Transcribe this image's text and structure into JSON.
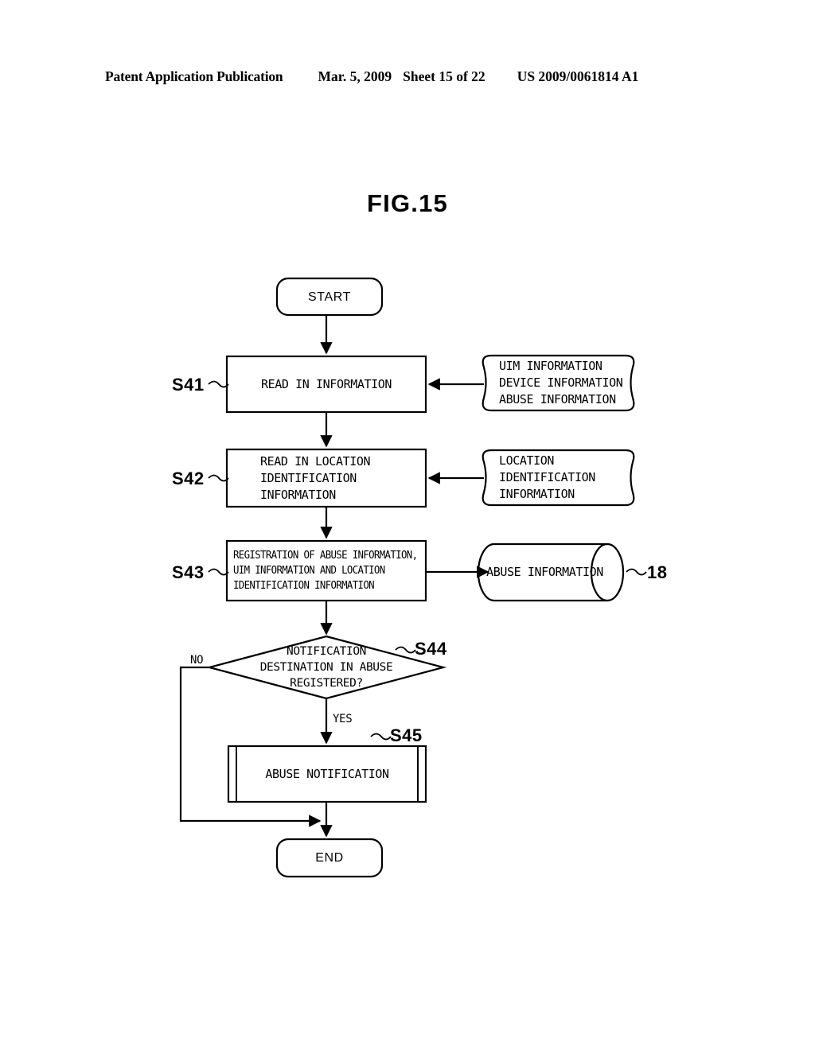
{
  "header": {
    "publication": "Patent Application Publication",
    "date": "Mar. 5, 2009",
    "sheet": "Sheet 15 of 22",
    "patent_number": "US 2009/0061814 A1"
  },
  "figure": {
    "title": "FIG.15"
  },
  "flowchart": {
    "start": {
      "label": "START"
    },
    "end": {
      "label": "END"
    },
    "s41": {
      "step": "S41",
      "line1": "READ IN INFORMATION"
    },
    "s41_data": {
      "line1": "UIM INFORMATION",
      "line2": "DEVICE INFORMATION",
      "line3": "ABUSE INFORMATION"
    },
    "s42": {
      "step": "S42",
      "line1": "READ IN LOCATION",
      "line2": "IDENTIFICATION",
      "line3": "INFORMATION"
    },
    "s42_data": {
      "line1": "LOCATION",
      "line2": "IDENTIFICATION",
      "line3": "INFORMATION"
    },
    "s43": {
      "step": "S43",
      "line1": "REGISTRATION OF ABUSE INFORMATION,",
      "line2": "UIM INFORMATION AND LOCATION",
      "line3": "IDENTIFICATION INFORMATION"
    },
    "s43_db": {
      "label": "ABUSE INFORMATION",
      "reference": "18"
    },
    "s44": {
      "step": "S44",
      "line1": "NOTIFICATION",
      "line2": "DESTINATION IN ABUSE",
      "line3": "REGISTERED?",
      "branch_no": "NO",
      "branch_yes": "YES"
    },
    "s45": {
      "step": "S45",
      "line1": "ABUSE NOTIFICATION"
    }
  },
  "colors": {
    "ink": "#000000",
    "paper": "#ffffff"
  }
}
